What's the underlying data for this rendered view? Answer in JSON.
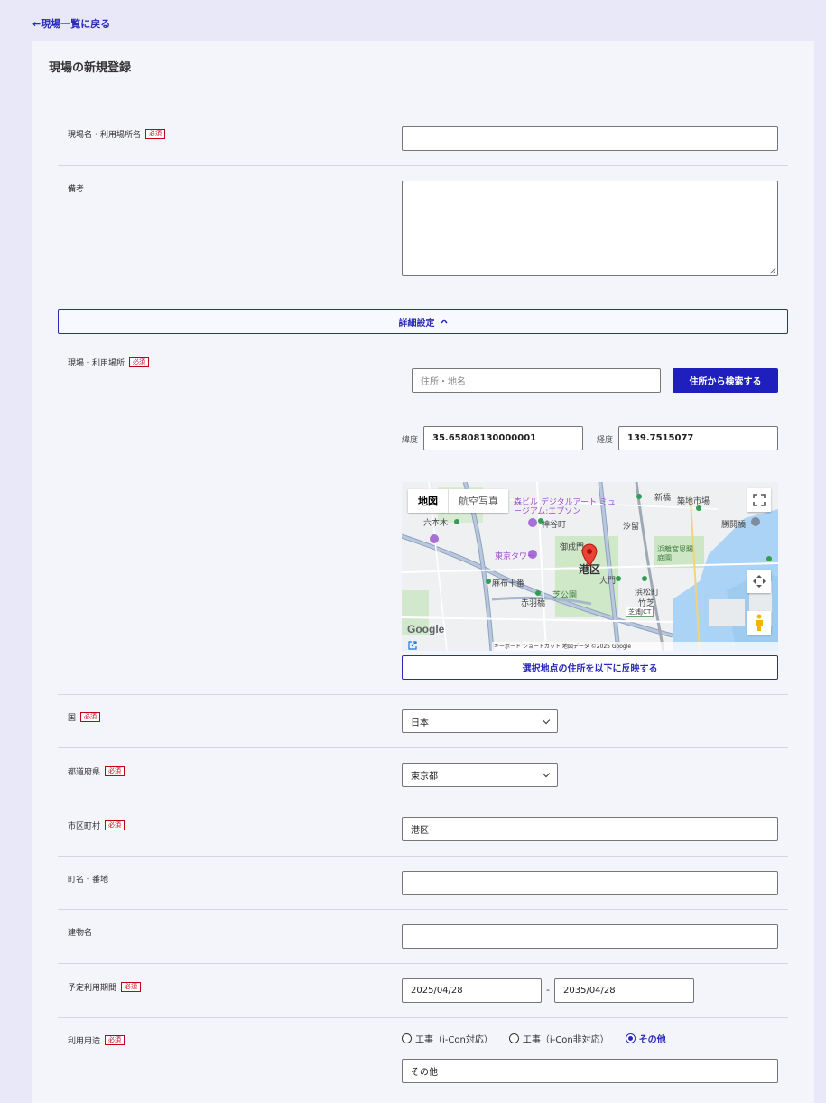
{
  "back_link": "←現場一覧に戻る",
  "page_title": "現場の新規登録",
  "required_badge": "必須",
  "site_name": {
    "label": "現場名・利用場所名",
    "value": ""
  },
  "remarks": {
    "label": "備考",
    "value": ""
  },
  "details_toggle": {
    "label": "詳細設定",
    "icon": "chevron-up-icon"
  },
  "location": {
    "label": "現場・利用場所",
    "address_placeholder": "住所・地名",
    "search_button": "住所から検索する",
    "lat_label": "緯度",
    "lat_value": "35.65808130000001",
    "lng_label": "経度",
    "lng_value": "139.7515077",
    "reflect_button": "選択地点の住所を以下に反映する"
  },
  "map": {
    "tab_map": "地図",
    "tab_satellite": "航空写真",
    "pin_label": "港区",
    "places": {
      "roppongi": "六本木",
      "tokyo_tower": "東京タワー",
      "onarimon": "御成門",
      "azabu_juban": "麻布十番",
      "shiba_park": "芝公園",
      "akabanebashi": "赤羽橋",
      "daimon": "大門",
      "hamamatsucho": "浜松町",
      "shiodome": "汐留",
      "kamiyacho": "神谷町",
      "shinbashi": "新橋",
      "hamarikyu": "浜離宮恩賜庭園",
      "tsukiji": "築地市場",
      "kachidoki": "勝鬨橋",
      "museum": "森ビル デジタルアート ミュージアム:エプソン",
      "takeshiba": "竹芝",
      "shibaura": "芝浦JCT"
    },
    "footer": "キーボード ショートカット   地図データ ©2025 Google",
    "logo": "Google"
  },
  "country": {
    "label": "国",
    "value": "日本"
  },
  "prefecture": {
    "label": "都道府県",
    "value": "東京都"
  },
  "city": {
    "label": "市区町村",
    "value": "港区"
  },
  "town": {
    "label": "町名・番地",
    "value": ""
  },
  "building": {
    "label": "建物名",
    "value": ""
  },
  "period": {
    "label": "予定利用期間",
    "start": "2025/04/28",
    "separator": "-",
    "end": "2035/04/28"
  },
  "usage": {
    "label": "利用用途",
    "options": [
      "工事（i-Con対応）",
      "工事（i-Con非対応）",
      "その他"
    ],
    "selected_index": 2,
    "other_value": "その他"
  },
  "colors": {
    "accent": "#1f1fbd",
    "required": "#c0001a",
    "background": "#e8e8f8",
    "card": "#f4f4fb"
  }
}
